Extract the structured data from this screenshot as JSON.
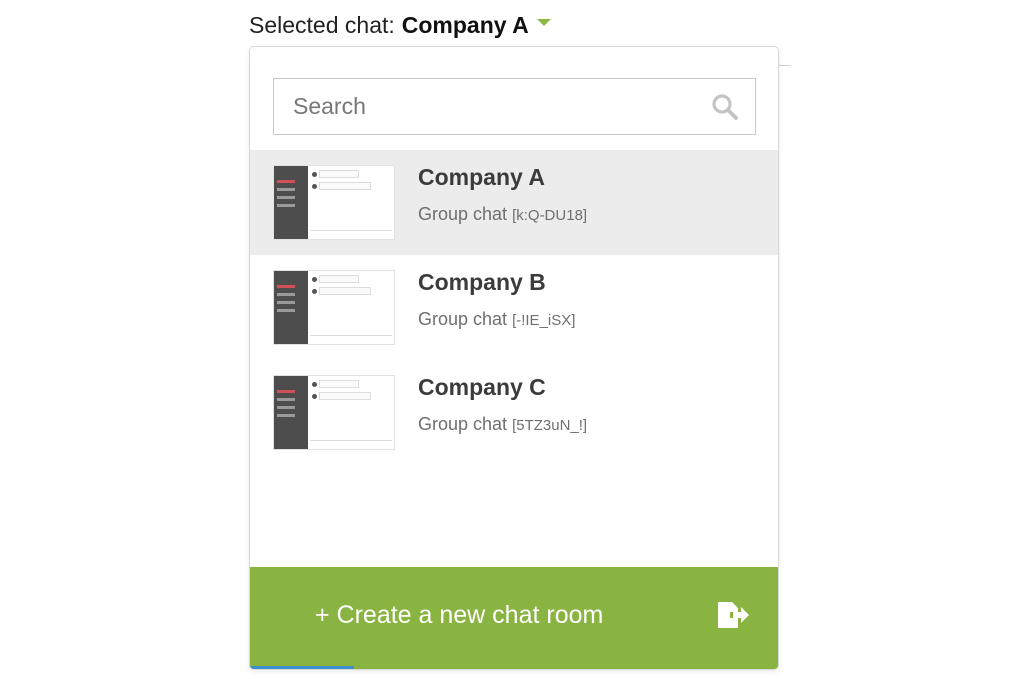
{
  "header": {
    "label": "Selected chat:",
    "selected": "Company A"
  },
  "search": {
    "placeholder": "Search"
  },
  "chats": [
    {
      "title": "Company A",
      "type": "Group chat",
      "code": "[k:Q-DU18]"
    },
    {
      "title": "Company B",
      "type": "Group chat",
      "code": "[-!IE_iSX]"
    },
    {
      "title": "Company C",
      "type": "Group chat",
      "code": "[5TZ3uN_!]"
    }
  ],
  "create_button": {
    "label": "+ Create a new chat room"
  },
  "colors": {
    "accent": "#8ab441",
    "active_row": "#ececec"
  },
  "icons": {
    "dropdown": "caret-down-icon",
    "search": "search-icon",
    "create": "exit-icon"
  }
}
